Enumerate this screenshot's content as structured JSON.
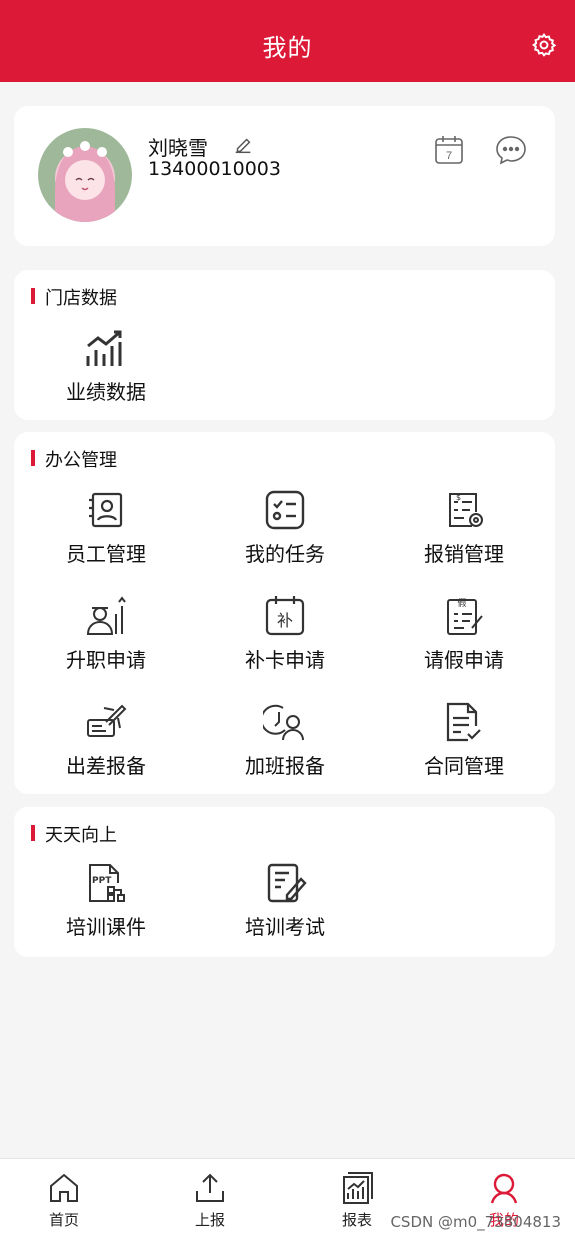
{
  "header": {
    "title": "我的"
  },
  "profile": {
    "name": "刘晓雪",
    "phone": "13400010003",
    "calendar_day": "7"
  },
  "sections": {
    "store": {
      "title": "门店数据",
      "items": [
        "业绩数据"
      ]
    },
    "office": {
      "title": "办公管理",
      "items": [
        "员工管理",
        "我的任务",
        "报销管理",
        "升职申请",
        "补卡申请",
        "请假申请",
        "出差报备",
        "加班报备",
        "合同管理"
      ]
    },
    "daily": {
      "title": "天天向上",
      "items": [
        "培训课件",
        "培训考试"
      ]
    }
  },
  "tabbar": {
    "items": [
      "首页",
      "上报",
      "报表",
      "我的"
    ],
    "active": "我的"
  },
  "watermark": "CSDN @m0_73804813",
  "colors": {
    "accent": "#dc1a38"
  }
}
